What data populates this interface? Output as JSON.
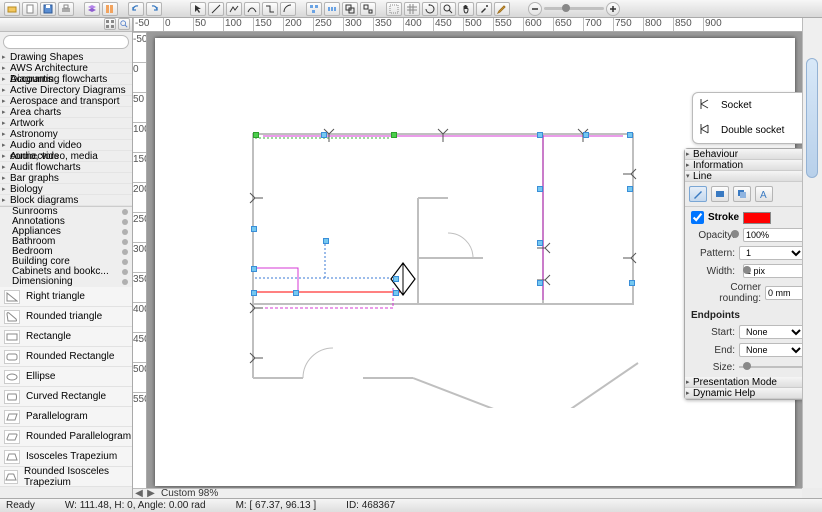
{
  "toolbar": {
    "buttons": [
      "open",
      "save",
      "print",
      "layers",
      "grid",
      "snap",
      "undo",
      "redo",
      "zoom-fit"
    ],
    "draw_tools": [
      "pointer",
      "line",
      "polyline",
      "curve",
      "connector",
      "rectangle",
      "rounded",
      "ellipse",
      "text",
      "align-left",
      "align-center",
      "distribute",
      "group",
      "ungroup",
      "rotate-left",
      "rotate-right",
      "flip",
      "find",
      "hand",
      "color-picker",
      "measure"
    ]
  },
  "ruler": {
    "h": [
      "-50",
      "0",
      "50",
      "100",
      "150",
      "200",
      "250",
      "300",
      "350",
      "400",
      "450",
      "500",
      "550",
      "600",
      "650",
      "700",
      "750",
      "800",
      "850",
      "900"
    ],
    "v": [
      "-50",
      "0",
      "50",
      "100",
      "150",
      "200",
      "250",
      "300",
      "350",
      "400",
      "450",
      "500",
      "550"
    ]
  },
  "sidebar": {
    "search_placeholder": "",
    "header": "Drawing Shapes",
    "categories": [
      "AWS Architecture Diagrams",
      "Accounting flowcharts",
      "Active Directory Diagrams",
      "Aerospace and transport",
      "Area charts",
      "Artwork",
      "Astronomy",
      "Audio and video connectors",
      "Audio, video, media",
      "Audit flowcharts",
      "Bar graphs",
      "Biology",
      "Block diagrams"
    ],
    "sub": [
      "Sunrooms",
      "Annotations",
      "Appliances",
      "Bathroom",
      "Bedroom",
      "Building core",
      "Cabinets and bookc...",
      "Dimensioning"
    ],
    "shapes": [
      "Right triangle",
      "Rounded triangle",
      "Rectangle",
      "Rounded Rectangle",
      "Ellipse",
      "Curved Rectangle",
      "Parallelogram",
      "Rounded Parallelogram",
      "Isosceles Trapezium",
      "Rounded Isosceles Trapezium"
    ]
  },
  "legend": {
    "row1": "Socket",
    "row2": "Double socket"
  },
  "props": {
    "sec1": "Behaviour",
    "sec2": "Information",
    "sec3": "Line",
    "stroke_label": "Stroke",
    "stroke_checked": true,
    "stroke_color": "#ff0000",
    "opacity_label": "Opacity:",
    "opacity_value": "100%",
    "pattern_label": "Pattern:",
    "pattern_value": "1",
    "width_label": "Width:",
    "width_value": "1 pix",
    "corner_label": "Corner rounding:",
    "corner_value": "0 mm",
    "endpoints": "Endpoints",
    "start_label": "Start:",
    "start_value": "None",
    "end_label": "End:",
    "end_value": "None",
    "size_label": "Size:",
    "sec4": "Presentation Mode",
    "sec5": "Dynamic Help"
  },
  "hscroll": {
    "prev": "◀",
    "next": "▶",
    "zoom_label": "Custom 98%"
  },
  "status": {
    "ready": "Ready",
    "wh": "W: 111.48, H: 0, Angle: 0.00 rad",
    "mouse": "M: [ 67.37, 96.13 ]",
    "id": "ID: 468367"
  }
}
